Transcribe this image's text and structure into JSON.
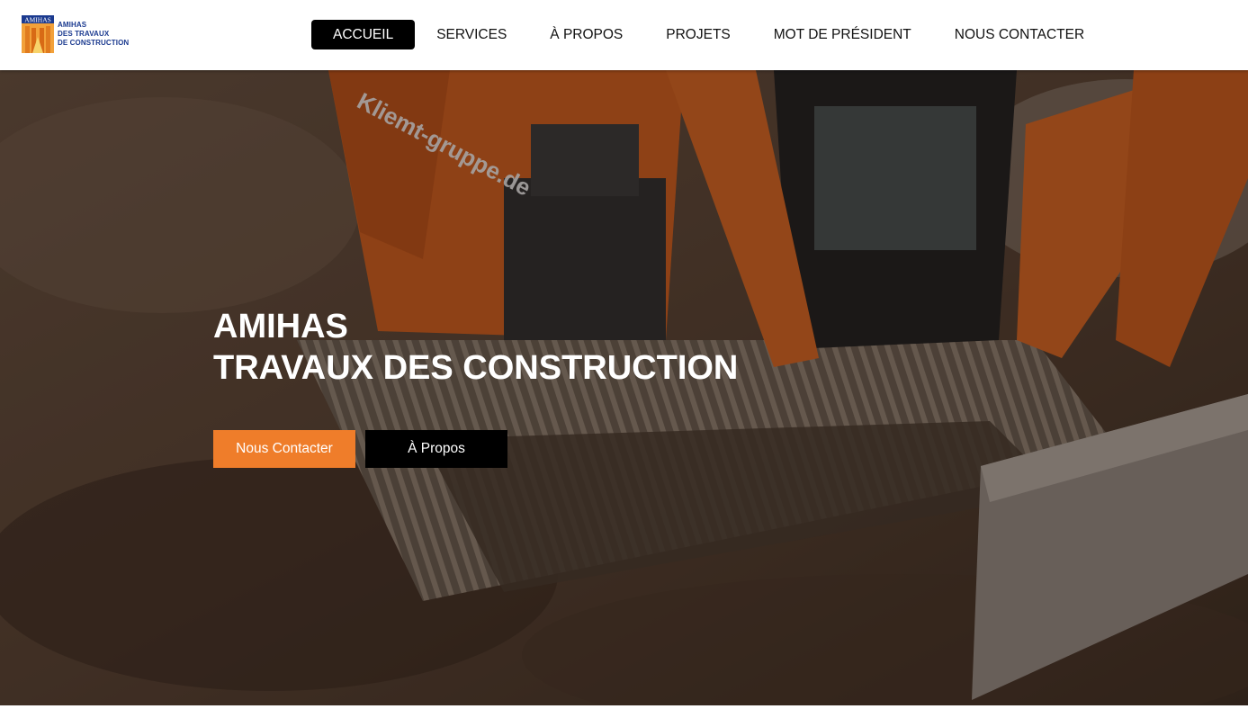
{
  "brand": {
    "logo_mark_text": "AMIHAS",
    "logo_lines": [
      "AMIHAS",
      "DES TRAVAUX",
      "DE CONSTRUCTION"
    ]
  },
  "nav": {
    "items": [
      {
        "label": "ACCUEIL",
        "active": true
      },
      {
        "label": "SERVICES",
        "active": false
      },
      {
        "label": "À PROPOS",
        "active": false
      },
      {
        "label": "PROJETS",
        "active": false
      },
      {
        "label": "MOT DE PRÉSIDENT",
        "active": false
      },
      {
        "label": "NOUS CONTACTER",
        "active": false
      }
    ]
  },
  "hero": {
    "title_line1": "AMIHAS",
    "title_line2": "TRAVAUX DES CONSTRUCTION",
    "background_image": "excavator-on-dirt",
    "machine_text": "Kliemt-gruppe.de",
    "buttons": {
      "contact_label": "Nous Contacter",
      "about_label": "À Propos"
    }
  },
  "colors": {
    "accent": "#ef7d2a",
    "nav_active_bg": "#000000",
    "logo_blue": "#1b3a8f"
  }
}
